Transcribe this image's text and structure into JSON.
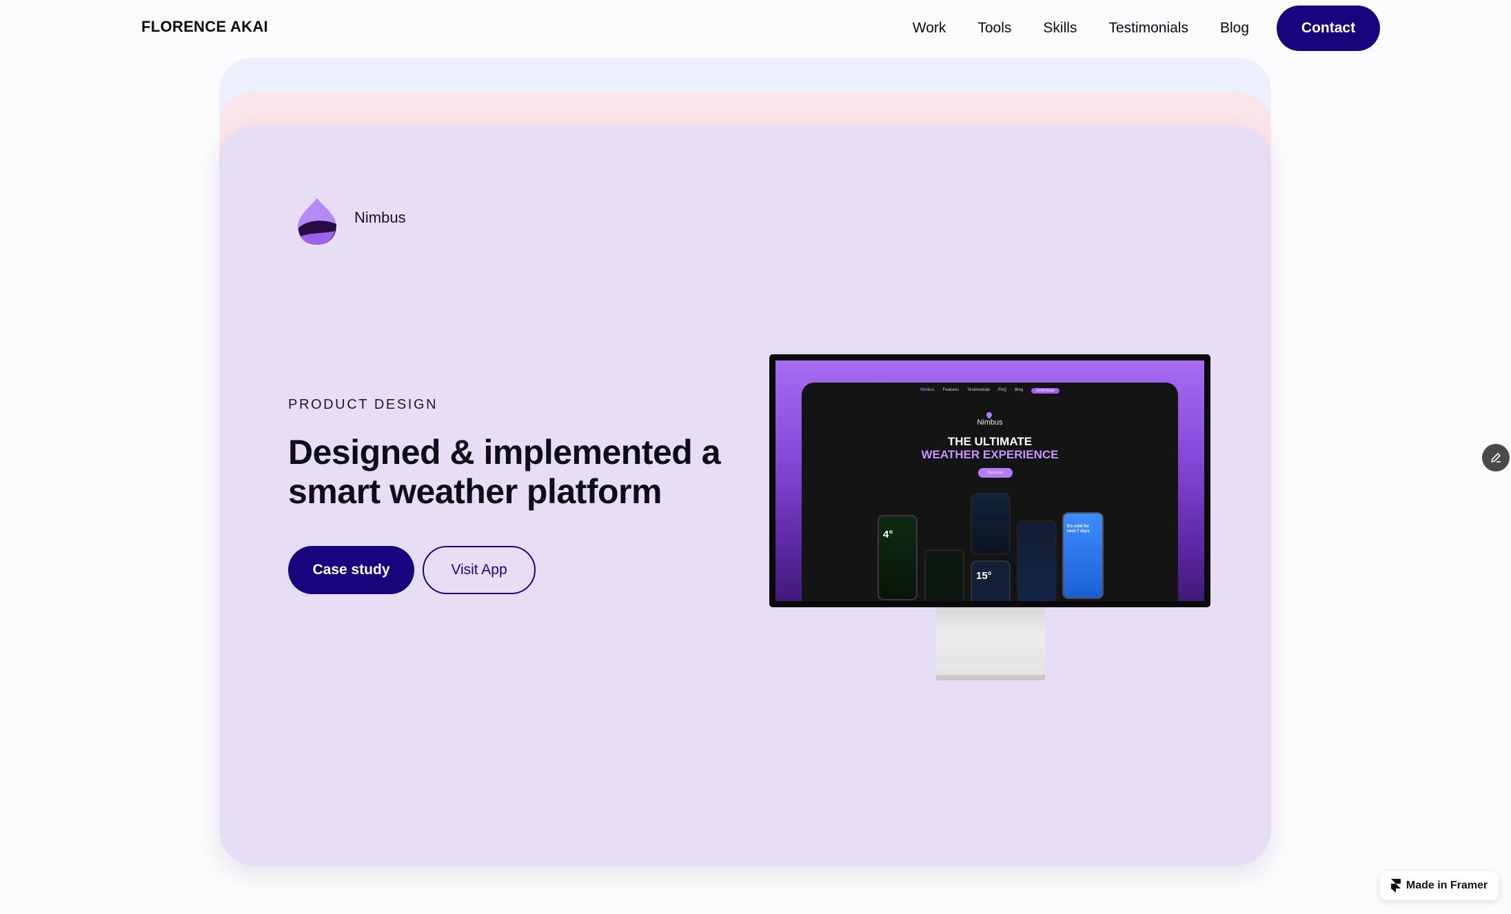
{
  "nav": {
    "brand": "FLORENCE AKAI",
    "links": [
      "Work",
      "Tools",
      "Skills",
      "Testimonials",
      "Blog"
    ],
    "contact_label": "Contact"
  },
  "project": {
    "app_name": "Nimbus",
    "category": "PRODUCT DESIGN",
    "headline": "Designed & implemented a smart weather platform",
    "case_study_label": "Case study",
    "visit_app_label": "Visit App",
    "accent_color": "#16057d",
    "card_color": "#e7def6"
  },
  "preview": {
    "nav_items": [
      "Nimbus",
      "Features",
      "Testimonials",
      "FAQ",
      "Blog"
    ],
    "nav_download": "Download",
    "brand": "Nimbus",
    "title_line1": "THE ULTIMATE",
    "title_line2": "WEATHER EXPERIENCE",
    "download_label": "Download",
    "phone_temp_1": "4°",
    "phone_temp_2": "15°",
    "phone_blue_text": "It's cold for next 7 days"
  },
  "badge": {
    "label": "Made in Framer"
  },
  "icons": {
    "edit": "pencil-icon",
    "framer": "framer-logo-icon",
    "logo": "nimbus-drop-logo"
  }
}
